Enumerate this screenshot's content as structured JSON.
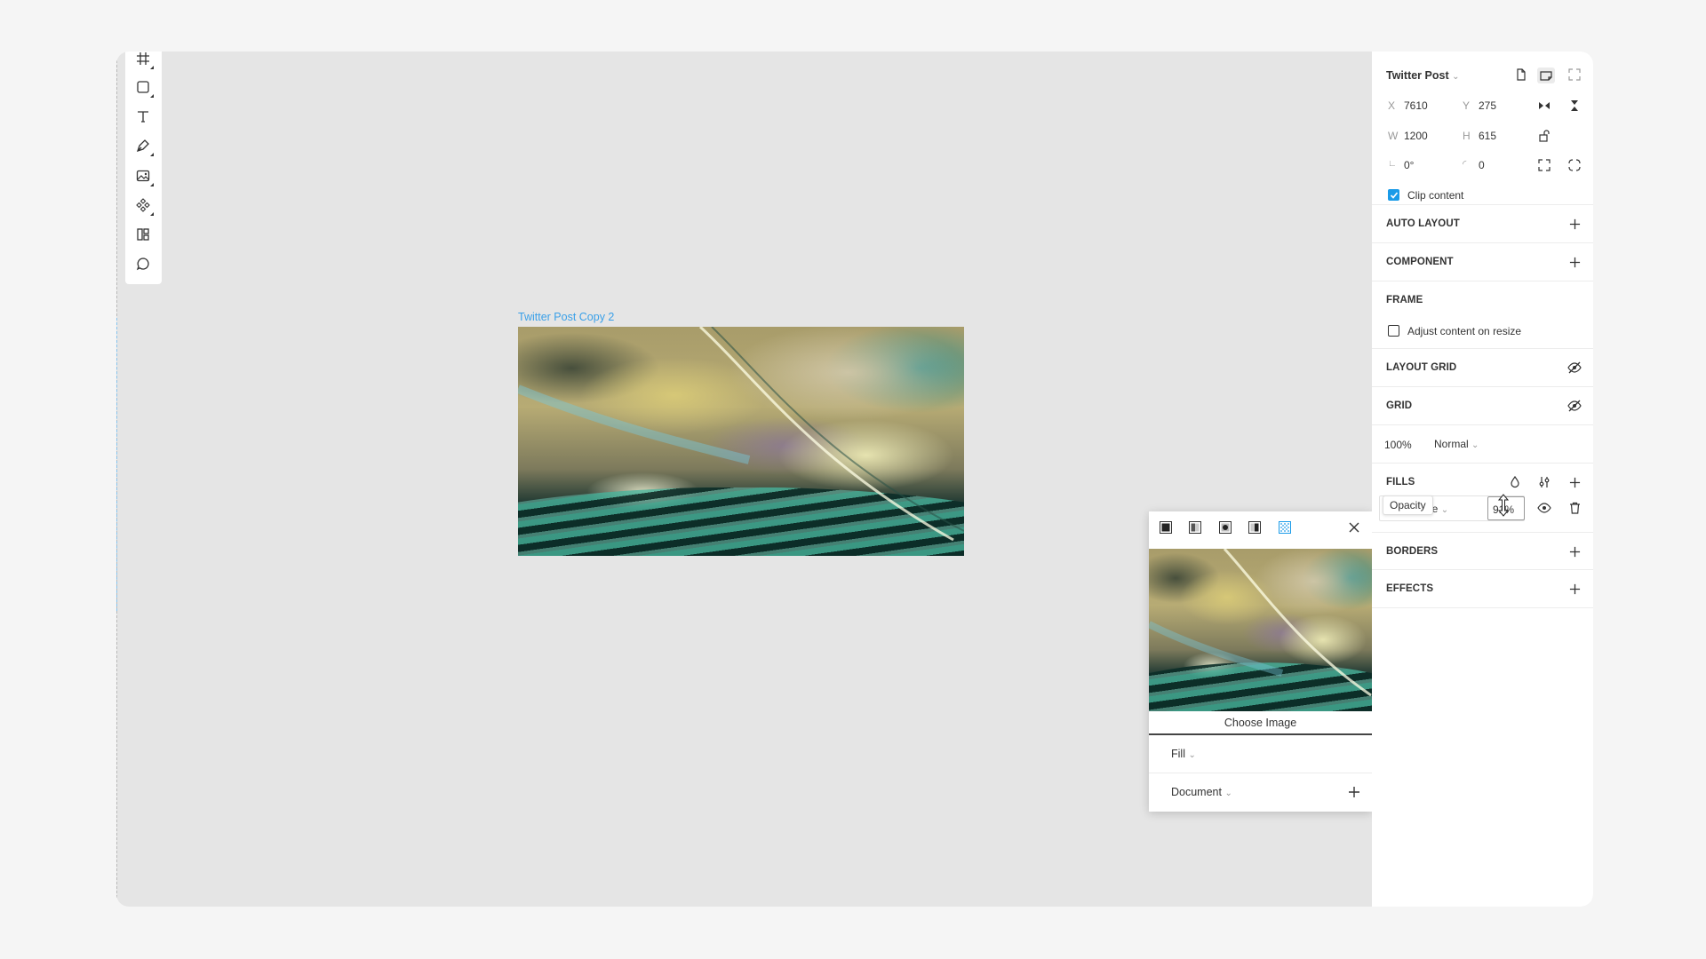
{
  "canvas": {
    "frame_label": "Twitter Post Copy 2"
  },
  "toolbar": {
    "tools": [
      "frame-tool",
      "rectangle-tool",
      "text-tool",
      "pen-tool",
      "image-tool",
      "component-tool",
      "plugins-tool",
      "comment-tool"
    ]
  },
  "panel": {
    "frame_name": "Twitter Post",
    "x_label": "X",
    "x_value": "7610",
    "y_label": "Y",
    "y_value": "275",
    "w_label": "W",
    "w_value": "1200",
    "h_label": "H",
    "h_value": "615",
    "rotation_value": "0°",
    "radius_value": "0",
    "clip_content_label": "Clip content",
    "clip_content_checked": true,
    "auto_layout_title": "AUTO LAYOUT",
    "component_title": "COMPONENT",
    "frame_title": "FRAME",
    "adjust_label": "Adjust content on resize",
    "layout_grid_title": "LAYOUT GRID",
    "grid_title": "GRID",
    "layer_opacity": "100%",
    "blend_mode": "Normal",
    "fills_title": "FILLS",
    "fill_type": "Image",
    "fill_opacity": "91%",
    "borders_title": "BORDERS",
    "effects_title": "EFFECTS",
    "accent_color": "#1a9be8"
  },
  "tooltip": {
    "text": "Opacity"
  },
  "popup": {
    "choose_image_label": "Choose Image",
    "scale_mode": "Fill",
    "source": "Document"
  }
}
